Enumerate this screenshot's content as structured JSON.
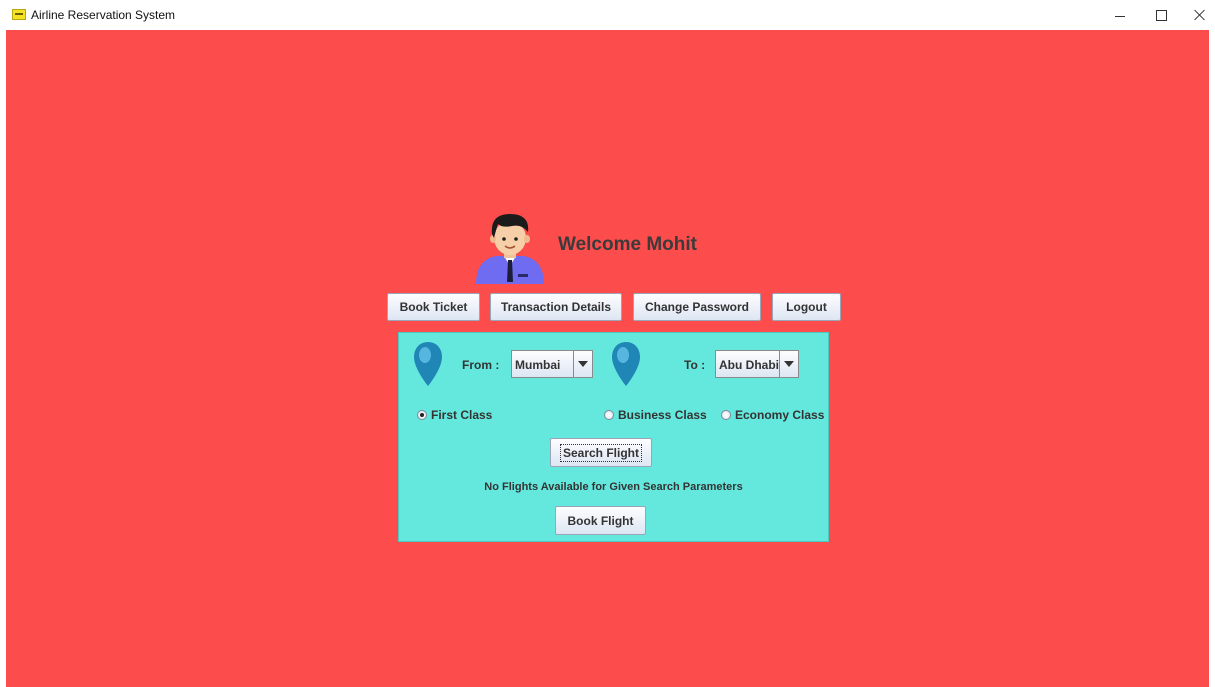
{
  "window": {
    "title": "Airline Reservation System",
    "controls": {
      "minimize": "minimize-icon",
      "maximize": "maximize-icon",
      "close": "close-icon"
    }
  },
  "colors": {
    "background": "#fd4c4c",
    "panel": "#64e8de",
    "pin": "#1f86b5",
    "avatar_shirt": "#6f6cf2"
  },
  "header": {
    "avatar_icon": "user-avatar-icon",
    "welcome_text": "Welcome Mohit"
  },
  "nav": {
    "book_ticket": "Book Ticket",
    "transaction_details": "Transaction Details",
    "change_password": "Change Password",
    "logout": "Logout"
  },
  "search": {
    "from_label": "From :",
    "from_value": "Mumbai",
    "to_label": "To :",
    "to_value": "Abu Dhabi",
    "pin_icon": "location-pin-icon",
    "classes": [
      {
        "label": "First Class",
        "selected": true
      },
      {
        "label": "Business Class",
        "selected": false
      },
      {
        "label": "Economy Class",
        "selected": false
      }
    ],
    "search_button": "Search Flight",
    "status_message": "No Flights Available for Given Search Parameters",
    "book_button": "Book Flight"
  }
}
